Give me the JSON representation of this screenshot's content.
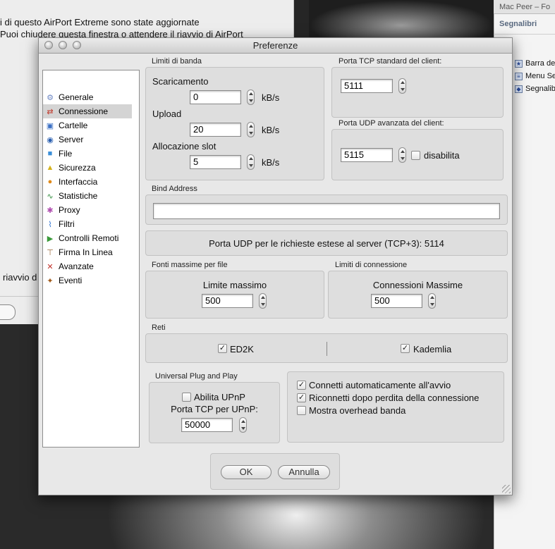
{
  "background": {
    "left_window_text": [
      "i di questo AirPort Extreme sono state aggiornate",
      "Puoi chiudere questa finestra o attendere il riavvio di AirPort",
      "riavvio d"
    ],
    "right_window": {
      "title": "Mac Peer – Fo",
      "subtitle": "Segnalibri",
      "items": [
        "Barra de",
        "Menu Se",
        "Segnalib"
      ]
    }
  },
  "window": {
    "title": "Preferenze"
  },
  "sidebar": {
    "items": [
      {
        "label": "Generale",
        "icon": "gear-icon",
        "color": "#6b86c4"
      },
      {
        "label": "Connessione",
        "icon": "connection-icon",
        "color": "#c0392b"
      },
      {
        "label": "Cartelle",
        "icon": "folder-icon",
        "color": "#3a6fc4"
      },
      {
        "label": "Server",
        "icon": "server-icon",
        "color": "#2a5fb0"
      },
      {
        "label": "File",
        "icon": "file-icon",
        "color": "#3b8fd9"
      },
      {
        "label": "Sicurezza",
        "icon": "lock-icon",
        "color": "#d4b21a"
      },
      {
        "label": "Interfaccia",
        "icon": "palette-icon",
        "color": "#e08a1a"
      },
      {
        "label": "Statistiche",
        "icon": "chart-icon",
        "color": "#2e8b3a"
      },
      {
        "label": "Proxy",
        "icon": "proxy-icon",
        "color": "#b04fb0"
      },
      {
        "label": "Filtri",
        "icon": "filter-icon",
        "color": "#2a6fd0"
      },
      {
        "label": "Controlli Remoti",
        "icon": "remote-icon",
        "color": "#3a9a3a"
      },
      {
        "label": "Firma In Linea",
        "icon": "signpost-icon",
        "color": "#9a6a3a"
      },
      {
        "label": "Avanzate",
        "icon": "tools-icon",
        "color": "#c0302a"
      },
      {
        "label": "Eventi",
        "icon": "events-icon",
        "color": "#a05a1a"
      }
    ],
    "selected_index": 1
  },
  "bandwidth": {
    "group_label": "Limiti di banda",
    "download_label": "Scaricamento",
    "download_value": "0",
    "upload_label": "Upload",
    "upload_value": "20",
    "slot_label": "Allocazione slot",
    "slot_value": "5",
    "unit": "kB/s"
  },
  "tcp_port": {
    "group_label": "Porta TCP standard del client:",
    "value": "5111"
  },
  "udp_port": {
    "group_label": "Porta UDP avanzata del client:",
    "value": "5115",
    "disable_label": "disabilita",
    "disable_checked": false
  },
  "bind_address": {
    "group_label": "Bind Address",
    "value": ""
  },
  "udp_extended_text": "Porta UDP per le richieste estese al server (TCP+3): 5114",
  "max_sources": {
    "group_label": "Fonti massime per file",
    "label": "Limite massimo",
    "value": "500"
  },
  "connection_limits": {
    "group_label": "Limiti di connessione",
    "label": "Connessioni Massime",
    "value": "500"
  },
  "networks": {
    "group_label": "Reti",
    "ed2k_label": "ED2K",
    "ed2k_checked": true,
    "kad_label": "Kademlia",
    "kad_checked": true
  },
  "upnp": {
    "group_label": "Universal Plug and Play",
    "enable_label": "Abilita UPnP",
    "enable_checked": false,
    "port_label": "Porta TCP per UPnP:",
    "port_value": "50000"
  },
  "options": {
    "autoconnect_label": "Connetti automaticamente all'avvio",
    "autoconnect_checked": true,
    "reconnect_label": "Riconnetti dopo perdita della connessione",
    "reconnect_checked": true,
    "overhead_label": "Mostra overhead banda",
    "overhead_checked": false
  },
  "buttons": {
    "ok": "OK",
    "cancel": "Annulla"
  }
}
